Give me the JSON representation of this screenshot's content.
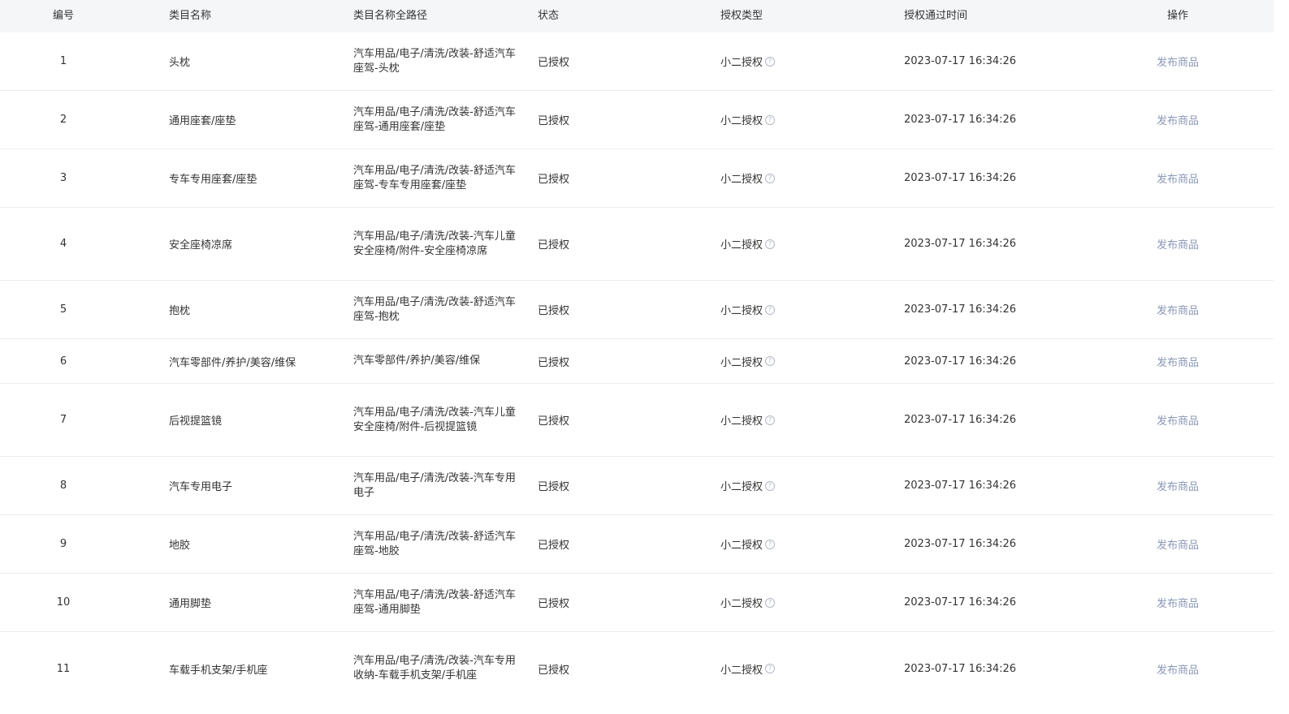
{
  "table": {
    "headers": {
      "num": "编号",
      "name": "类目名称",
      "path": "类目名称全路径",
      "status": "状态",
      "auth_type": "授权类型",
      "time": "授权通过时间",
      "action": "操作"
    },
    "rows": [
      {
        "num": "1",
        "name": "头枕",
        "path": "汽车用品/电子/清洗/改装-舒适汽车座驾-头枕",
        "status": "已授权",
        "auth_type": "小二授权",
        "time": "2023-07-17 16:34:26",
        "action": "发布商品"
      },
      {
        "num": "2",
        "name": "通用座套/座垫",
        "path": "汽车用品/电子/清洗/改装-舒适汽车座驾-通用座套/座垫",
        "status": "已授权",
        "auth_type": "小二授权",
        "time": "2023-07-17 16:34:26",
        "action": "发布商品"
      },
      {
        "num": "3",
        "name": "专车专用座套/座垫",
        "path": "汽车用品/电子/清洗/改装-舒适汽车座驾-专车专用座套/座垫",
        "status": "已授权",
        "auth_type": "小二授权",
        "time": "2023-07-17 16:34:26",
        "action": "发布商品"
      },
      {
        "num": "4",
        "name": "安全座椅凉席",
        "path": "汽车用品/电子/清洗/改装-汽车儿童安全座椅/附件-安全座椅凉席",
        "status": "已授权",
        "auth_type": "小二授权",
        "time": "2023-07-17 16:34:26",
        "action": "发布商品"
      },
      {
        "num": "5",
        "name": "抱枕",
        "path": "汽车用品/电子/清洗/改装-舒适汽车座驾-抱枕",
        "status": "已授权",
        "auth_type": "小二授权",
        "time": "2023-07-17 16:34:26",
        "action": "发布商品"
      },
      {
        "num": "6",
        "name": "汽车零部件/养护/美容/维保",
        "path": "汽车零部件/养护/美容/维保",
        "status": "已授权",
        "auth_type": "小二授权",
        "time": "2023-07-17 16:34:26",
        "action": "发布商品"
      },
      {
        "num": "7",
        "name": "后视提篮镜",
        "path": "汽车用品/电子/清洗/改装-汽车儿童安全座椅/附件-后视提篮镜",
        "status": "已授权",
        "auth_type": "小二授权",
        "time": "2023-07-17 16:34:26",
        "action": "发布商品"
      },
      {
        "num": "8",
        "name": "汽车专用电子",
        "path": "汽车用品/电子/清洗/改装-汽车专用电子",
        "status": "已授权",
        "auth_type": "小二授权",
        "time": "2023-07-17 16:34:26",
        "action": "发布商品"
      },
      {
        "num": "9",
        "name": "地胶",
        "path": "汽车用品/电子/清洗/改装-舒适汽车座驾-地胶",
        "status": "已授权",
        "auth_type": "小二授权",
        "time": "2023-07-17 16:34:26",
        "action": "发布商品"
      },
      {
        "num": "10",
        "name": "通用脚垫",
        "path": "汽车用品/电子/清洗/改装-舒适汽车座驾-通用脚垫",
        "status": "已授权",
        "auth_type": "小二授权",
        "time": "2023-07-17 16:34:26",
        "action": "发布商品"
      },
      {
        "num": "11",
        "name": "车载手机支架/手机座",
        "path": "汽车用品/电子/清洗/改装-汽车专用收纳-车载手机支架/手机座",
        "status": "已授权",
        "auth_type": "小二授权",
        "time": "2023-07-17 16:34:26",
        "action": "发布商品"
      }
    ]
  },
  "icons": {
    "help": "question-circle-icon"
  },
  "colors": {
    "action_link": "#8a97b6",
    "header_bg": "#f5f6f8"
  }
}
